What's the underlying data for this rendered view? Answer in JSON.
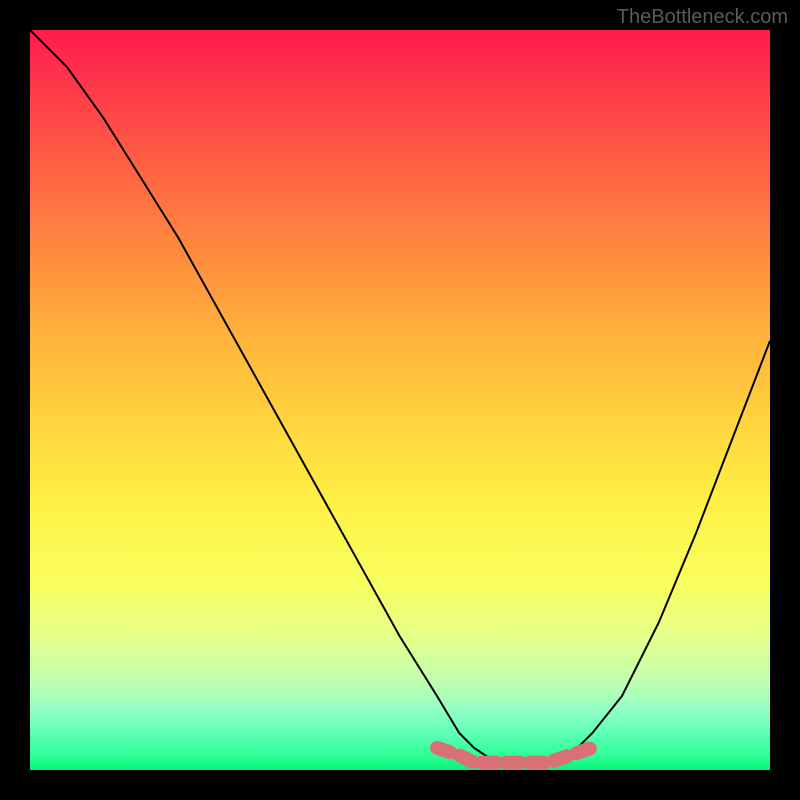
{
  "watermark": "TheBottleneck.com",
  "chart_data": {
    "type": "line",
    "title": "",
    "xlabel": "",
    "ylabel": "",
    "xlim": [
      0,
      100
    ],
    "ylim": [
      0,
      100
    ],
    "series": [
      {
        "name": "bottleneck-curve",
        "x": [
          0,
          5,
          10,
          15,
          20,
          25,
          30,
          35,
          40,
          45,
          50,
          55,
          58,
          60,
          63,
          66,
          70,
          73,
          76,
          80,
          85,
          90,
          95,
          100
        ],
        "y": [
          100,
          95,
          88,
          80,
          72,
          63,
          54,
          45,
          36,
          27,
          18,
          10,
          5,
          3,
          1,
          1,
          1,
          2,
          5,
          10,
          20,
          32,
          45,
          58
        ],
        "color": "#000000"
      },
      {
        "name": "optimal-range-marker",
        "x": [
          55,
          58,
          60,
          63,
          66,
          70,
          73,
          76
        ],
        "y": [
          3,
          2,
          1,
          1,
          1,
          1,
          2,
          3
        ],
        "color": "#d97076"
      }
    ],
    "gradient_stops": [
      {
        "pos": 0.0,
        "color": "#ff1a4e"
      },
      {
        "pos": 0.18,
        "color": "#ff6044"
      },
      {
        "pos": 0.42,
        "color": "#ffb43c"
      },
      {
        "pos": 0.65,
        "color": "#fff247"
      },
      {
        "pos": 0.88,
        "color": "#c0ffb0"
      },
      {
        "pos": 1.0,
        "color": "#05f47a"
      }
    ]
  }
}
